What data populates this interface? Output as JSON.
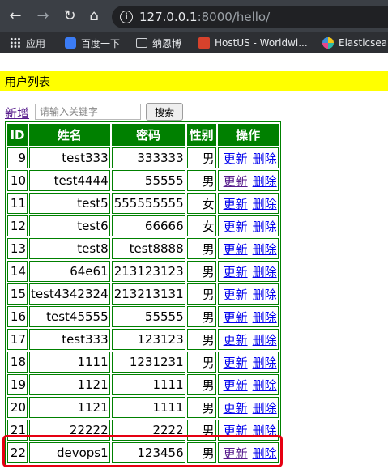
{
  "browser": {
    "url_host": "127.0.0.1",
    "url_rest": ":8000/hello/",
    "bookmarks": [
      "应用",
      "百度一下",
      "纳恩博",
      "HostUS - Worldwi...",
      "Elasticsea"
    ]
  },
  "page": {
    "title": "用户列表",
    "add_label": "新增",
    "search_placeholder": "请输入关键字",
    "search_button": "搜索"
  },
  "table": {
    "headers": [
      "ID",
      "姓名",
      "密码",
      "性别",
      "操作"
    ],
    "action_labels": {
      "update": "更新",
      "delete": "删除"
    },
    "rows": [
      {
        "id": "9",
        "name": "test333",
        "password": "333333",
        "sex": "男"
      },
      {
        "id": "10",
        "name": "test4444",
        "password": "55555",
        "sex": "男"
      },
      {
        "id": "11",
        "name": "test5",
        "password": "555555555",
        "sex": "女"
      },
      {
        "id": "12",
        "name": "test6",
        "password": "66666",
        "sex": "女"
      },
      {
        "id": "13",
        "name": "test8",
        "password": "test8888",
        "sex": "男"
      },
      {
        "id": "14",
        "name": "64e61",
        "password": "213123123",
        "sex": "男"
      },
      {
        "id": "15",
        "name": "test4342324",
        "password": "213213131",
        "sex": "男"
      },
      {
        "id": "16",
        "name": "test45555",
        "password": "55555",
        "sex": "男"
      },
      {
        "id": "17",
        "name": "test333",
        "password": "123123",
        "sex": "男"
      },
      {
        "id": "18",
        "name": "1111",
        "password": "1231231",
        "sex": "男"
      },
      {
        "id": "19",
        "name": "1121",
        "password": "1111",
        "sex": "男"
      },
      {
        "id": "20",
        "name": "1121",
        "password": "1111",
        "sex": "男"
      },
      {
        "id": "21",
        "name": "22222",
        "password": "2222",
        "sex": "男"
      },
      {
        "id": "22",
        "name": "devops1",
        "password": "123456",
        "sex": "男"
      }
    ]
  },
  "colors": {
    "table_green": "#008000",
    "banner_yellow": "#ffff00",
    "highlight_red": "#e60012"
  }
}
